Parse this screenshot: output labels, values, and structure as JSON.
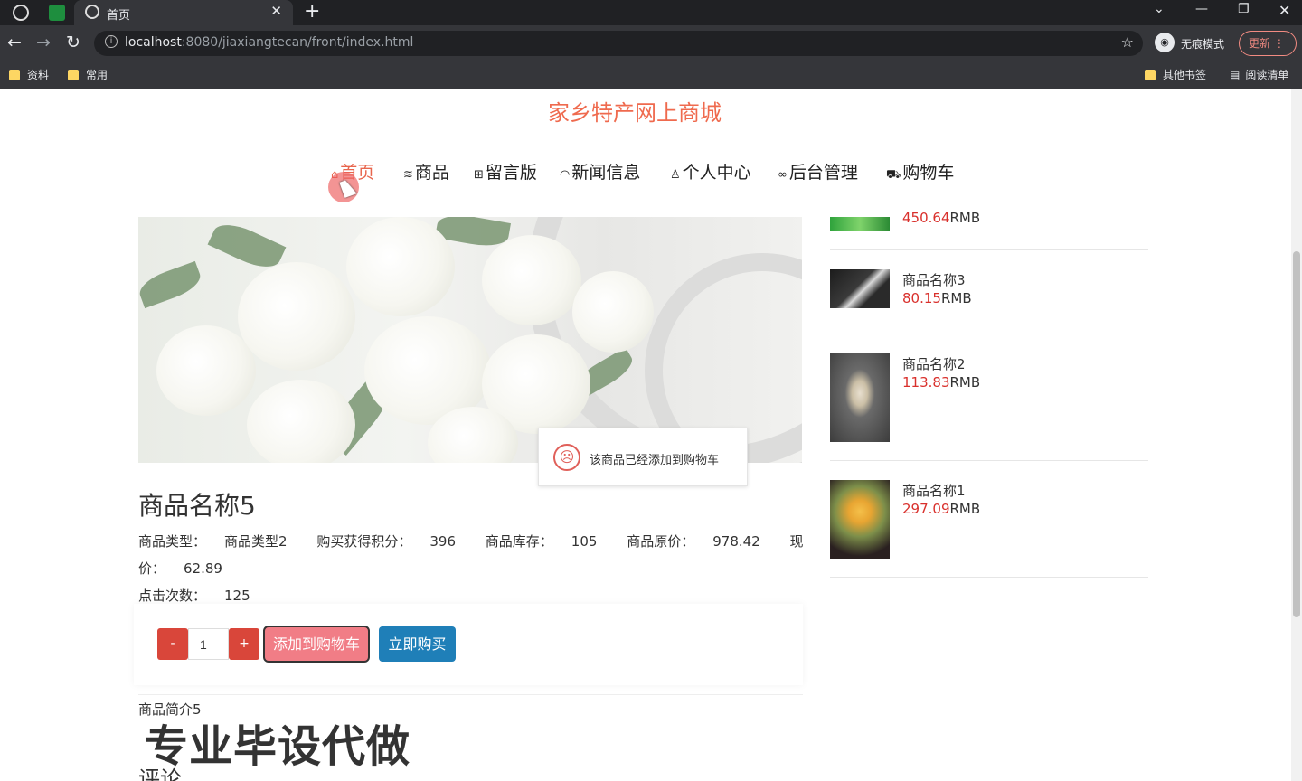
{
  "browser": {
    "tab_title": "首页",
    "url_host": "localhost",
    "url_rest": ":8080/jiaxiangtecan/front/index.html",
    "incognito_label": "无痕模式",
    "update_label": "更新",
    "bookmarks": [
      "资料",
      "常用"
    ],
    "bookmarks_right": [
      "其他书签",
      "阅读清单"
    ]
  },
  "site": {
    "title": "家乡特产网上商城",
    "nav": [
      {
        "label": "首页",
        "icon": "home-icon"
      },
      {
        "label": "商品",
        "icon": "layers-icon"
      },
      {
        "label": "留言版",
        "icon": "gift-icon"
      },
      {
        "label": "新闻信息",
        "icon": "gauge-icon"
      },
      {
        "label": "个人中心",
        "icon": "user-icon"
      },
      {
        "label": "后台管理",
        "icon": "link-icon"
      },
      {
        "label": "购物车",
        "icon": "cart-icon"
      }
    ]
  },
  "toast": {
    "message": "该商品已经添加到购物车"
  },
  "product": {
    "name": "商品名称5",
    "type_label": "商品类型：",
    "type_value": "商品类型2",
    "points_label": "购买获得积分：",
    "points_value": "396",
    "stock_label": "商品库存：",
    "stock_value": "105",
    "orig_price_label": "商品原价：",
    "orig_price_value": "978.42",
    "price_label": "现价：",
    "price_value": "62.89",
    "clicks_label": "点击次数：",
    "clicks_value": "125",
    "quantity": "1",
    "minus_label": "-",
    "plus_label": "+",
    "add_cart_label": "添加到购物车",
    "buy_now_label": "立即购买",
    "intro": "商品简介5",
    "comments_heading": "评论"
  },
  "watermark": "专业毕设代做",
  "sidebar": [
    {
      "price": "450.64",
      "unit": "RMB"
    },
    {
      "name": "商品名称3",
      "price": "80.15",
      "unit": "RMB"
    },
    {
      "name": "商品名称2",
      "price": "113.83",
      "unit": "RMB"
    },
    {
      "name": "商品名称1",
      "price": "297.09",
      "unit": "RMB"
    }
  ],
  "colors": {
    "accent": "#e8664e",
    "price_red": "#d9302c",
    "cart_button": "#f17d86",
    "buy_button": "#1f7fb8"
  }
}
